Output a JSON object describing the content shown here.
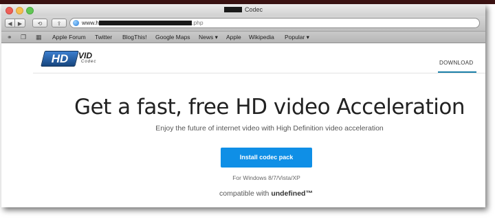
{
  "window": {
    "title_suffix": "Codec"
  },
  "toolbar": {
    "back_icon": "◀",
    "forward_icon": "▶",
    "history_icon": "⟲",
    "share_icon": "⇪",
    "url_prefix": "www.h",
    "url_suffix": ".php"
  },
  "bookmarks": {
    "items": [
      {
        "label": "Apple Forum"
      },
      {
        "label": "Twitter"
      },
      {
        "label": "BlogThis!"
      },
      {
        "label": "Google Maps"
      },
      {
        "label": "News ▾"
      },
      {
        "label": "Apple"
      },
      {
        "label": "Wikipedia"
      },
      {
        "label": "Popular ▾"
      }
    ]
  },
  "page": {
    "logo_main": "HD",
    "logo_vid": "VID",
    "logo_codec": "Codec",
    "nav_download": "DOWNLOAD",
    "headline": "Get a fast, free HD video Acceleration",
    "subline": "Enjoy the future of internet video with High Definition video acceleration",
    "install_button": "Install codec pack",
    "platform_note": "For Windows 8/7/Vista/XP",
    "compat_prefix": "compatible with ",
    "compat_bold": "undefined™"
  }
}
